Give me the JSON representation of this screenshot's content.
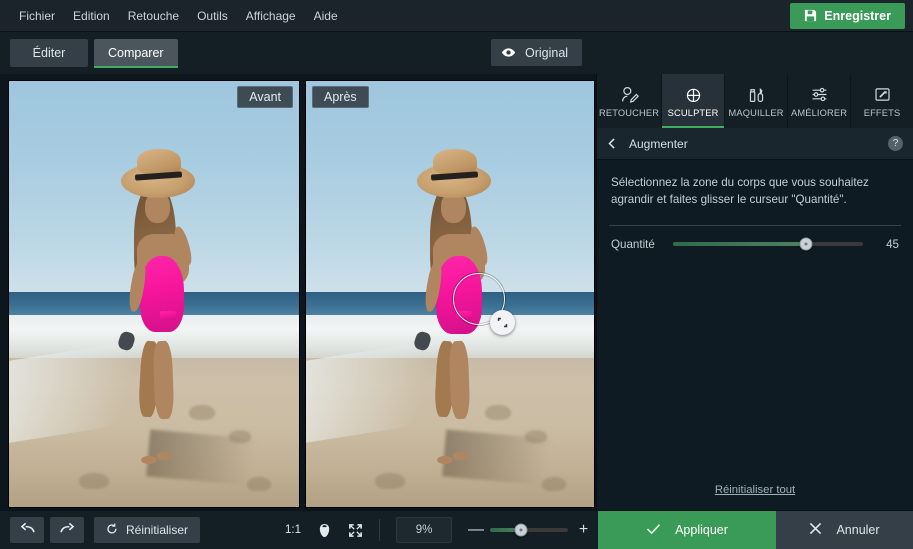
{
  "app": {
    "accent_green": "#3a9a58",
    "panel_bg": "#0f1b22",
    "chrome_bg": "#131e25"
  },
  "menubar": {
    "items": [
      {
        "label": "Fichier"
      },
      {
        "label": "Edition"
      },
      {
        "label": "Retouche"
      },
      {
        "label": "Outils"
      },
      {
        "label": "Affichage"
      },
      {
        "label": "Aide"
      }
    ],
    "save_label": "Enregistrer",
    "save_icon": "floppy-disk-icon"
  },
  "toolbar": {
    "tabs": [
      {
        "label": "Éditer",
        "active": false
      },
      {
        "label": "Comparer",
        "active": true
      }
    ],
    "original_toggle": {
      "label": "Original",
      "icon": "eye-icon"
    }
  },
  "canvas": {
    "before_label": "Avant",
    "after_label": "Après",
    "brush_cursor": {
      "icon": "resize-handle-icon",
      "visible": true
    }
  },
  "right_panel": {
    "tabs": [
      {
        "label": "RETOUCHER",
        "icon": "face-retouch-icon",
        "active": false
      },
      {
        "label": "SCULPTER",
        "icon": "sculpt-target-icon",
        "active": true
      },
      {
        "label": "MAQUILLER",
        "icon": "makeup-icon",
        "active": false
      },
      {
        "label": "AMÉLIORER",
        "icon": "sliders-icon",
        "active": false
      },
      {
        "label": "EFFETS",
        "icon": "effects-magic-icon",
        "active": false
      }
    ],
    "header": {
      "back_icon": "chevron-left-icon",
      "title": "Augmenter",
      "help_icon": "question-mark-icon",
      "help_label": "?"
    },
    "instructions": "Sélectionnez la zone du corps que vous souhaitez agrandir et faites glisser le curseur \"Quantité\".",
    "slider": {
      "label": "Quantité",
      "value": "45",
      "percent": 70,
      "min": 0,
      "max": 100
    },
    "reset_all_label": "Réinitialiser tout"
  },
  "bottombar": {
    "undo_icon": "undo-arrow-icon",
    "redo_icon": "redo-arrow-icon",
    "reset_label": "Réinitialiser",
    "reset_icon": "refresh-icon",
    "ratio_label": "1:1",
    "face_icon": "face-fit-icon",
    "fit_icon": "expand-fullscreen-icon",
    "zoom_value": "9%",
    "zoom_percent": 40,
    "zoom_out_label": "—",
    "zoom_in_label": "+",
    "apply_label": "Appliquer",
    "apply_icon": "checkmark-icon",
    "cancel_label": "Annuler",
    "cancel_icon": "close-x-icon"
  }
}
